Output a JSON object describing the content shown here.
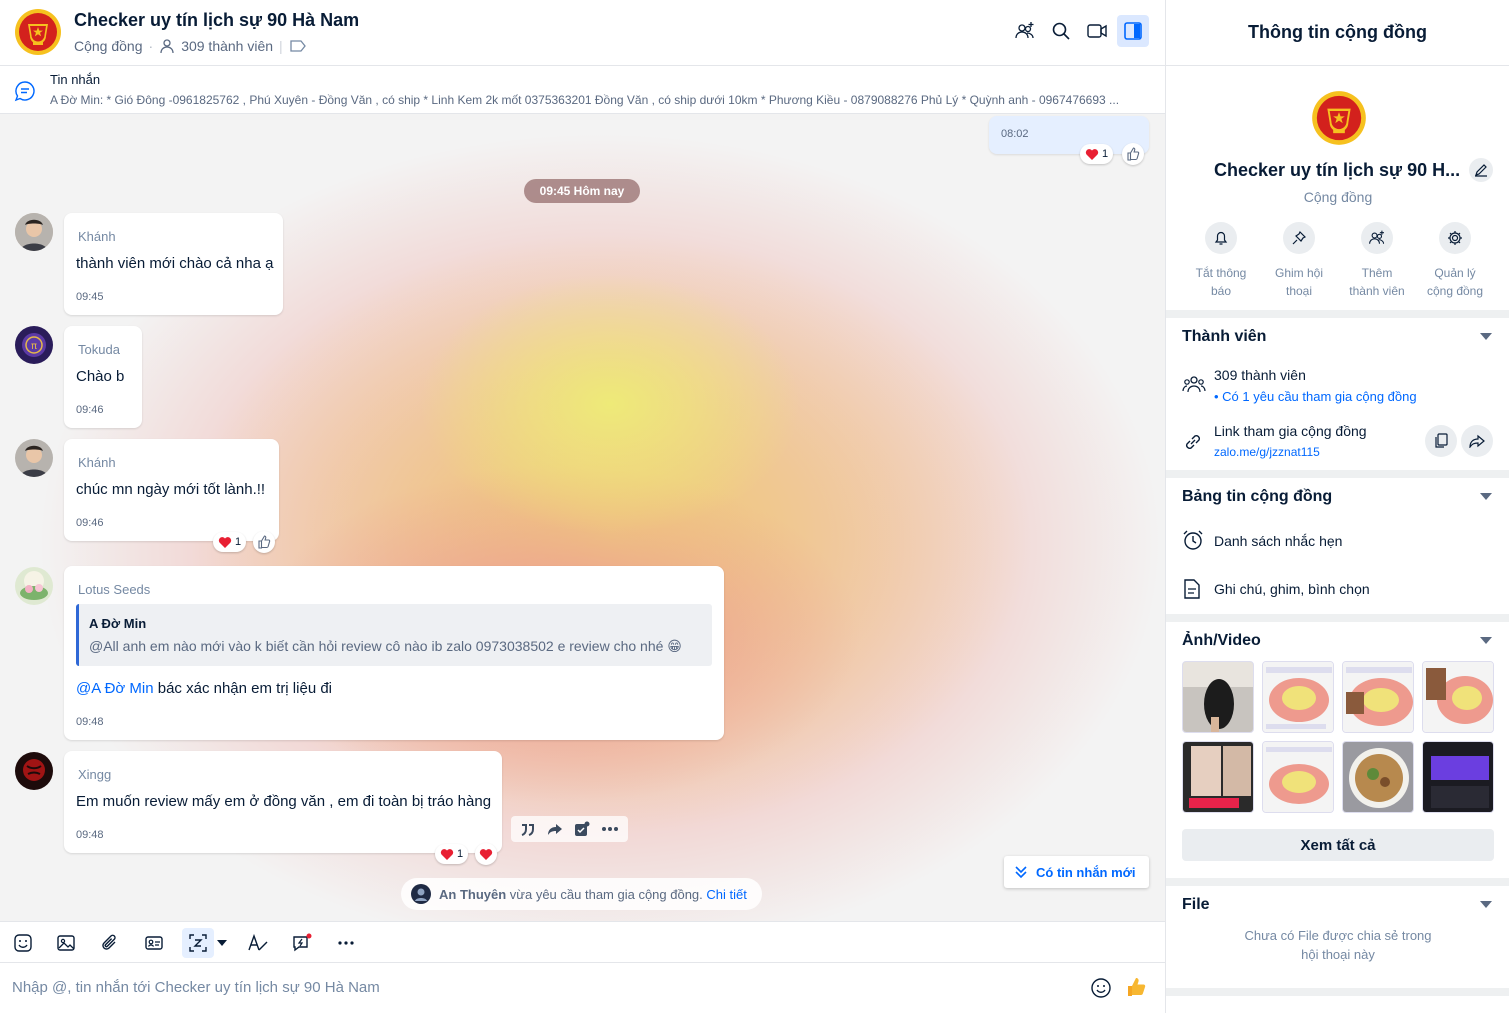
{
  "header": {
    "title": "Checker uy tín lịch sự 90 Hà Nam",
    "type_label": "Cộng đồng",
    "member_count": "309 thành viên"
  },
  "pinned": {
    "title": "Tin nhắn",
    "text": "A Đờ Min: * Gió Đông -0961825762 , Phú Xuyên - Đồng Văn , có ship * Linh Kem 2k mốt 0375363201 Đồng Văn , có ship dưới 10km * Phương Kiều - 0879088276 Phủ Lý * Quỳnh anh - 0967476693 ..."
  },
  "chat": {
    "self_time": "08:02",
    "self_reaction_count": "1",
    "separator": "09:45 Hôm nay",
    "messages": [
      {
        "sender": "Khánh",
        "text": "thành viên mới chào cả nha ạ",
        "time": "09:45"
      },
      {
        "sender": "Tokuda",
        "text": "Chào b",
        "time": "09:46"
      },
      {
        "sender": "Khánh",
        "text": "chúc mn ngày mới tốt lành.!!",
        "time": "09:46",
        "reaction_count": "1"
      },
      {
        "sender": "Lotus Seeds",
        "quote_name": "A Đờ Min",
        "quote_text": "@All anh em nào mới vào k biết cần hỏi review cô nào ib zalo 0973038502 e review cho nhé 😁",
        "mention": "@A Đờ Min",
        "text": " bác xác nhận em trị liệu đi",
        "time": "09:48"
      },
      {
        "sender": "Xingg",
        "text": "Em muốn review mấy em ở đồng văn , em đi toàn bị tráo hàng",
        "time": "09:48",
        "reaction_count": "1"
      }
    ],
    "new_messages": "Có tin nhắn mới",
    "join_name": "An Thuyên",
    "join_text": " vừa yêu cầu tham gia cộng đồng. ",
    "join_link": "Chi tiết"
  },
  "composer": {
    "placeholder": "Nhập @, tin nhắn tới Checker uy tín lịch sự 90 Hà Nam"
  },
  "panel": {
    "title": "Thông tin cộng đồng",
    "name": "Checker uy tín lịch sự 90 H...",
    "type": "Cộng đồng",
    "actions": [
      {
        "line1": "Tắt thông",
        "line2": "báo"
      },
      {
        "line1": "Ghim hội",
        "line2": "thoại"
      },
      {
        "line1": "Thêm",
        "line2": "thành viên"
      },
      {
        "line1": "Quản lý",
        "line2": "cộng đồng"
      }
    ],
    "members": {
      "title": "Thành viên",
      "count": "309 thành viên",
      "request": "Có 1 yêu cầu tham gia cộng đồng",
      "link_label": "Link tham gia cộng đồng",
      "link": "zalo.me/g/jzznat115"
    },
    "board": {
      "title": "Bảng tin cộng đồng",
      "reminders": "Danh sách nhắc hẹn",
      "notes": "Ghi chú, ghim, bình chọn"
    },
    "media": {
      "title": "Ảnh/Video",
      "view_all": "Xem tất cả"
    },
    "file": {
      "title": "File",
      "empty_line1": "Chưa có File được chia sẻ trong",
      "empty_line2": "hội thoại này"
    }
  },
  "colors": {
    "accent": "#0068ff",
    "heart": "#e81f32",
    "logo_red": "#d3211d",
    "logo_gold": "#f6c11f"
  }
}
